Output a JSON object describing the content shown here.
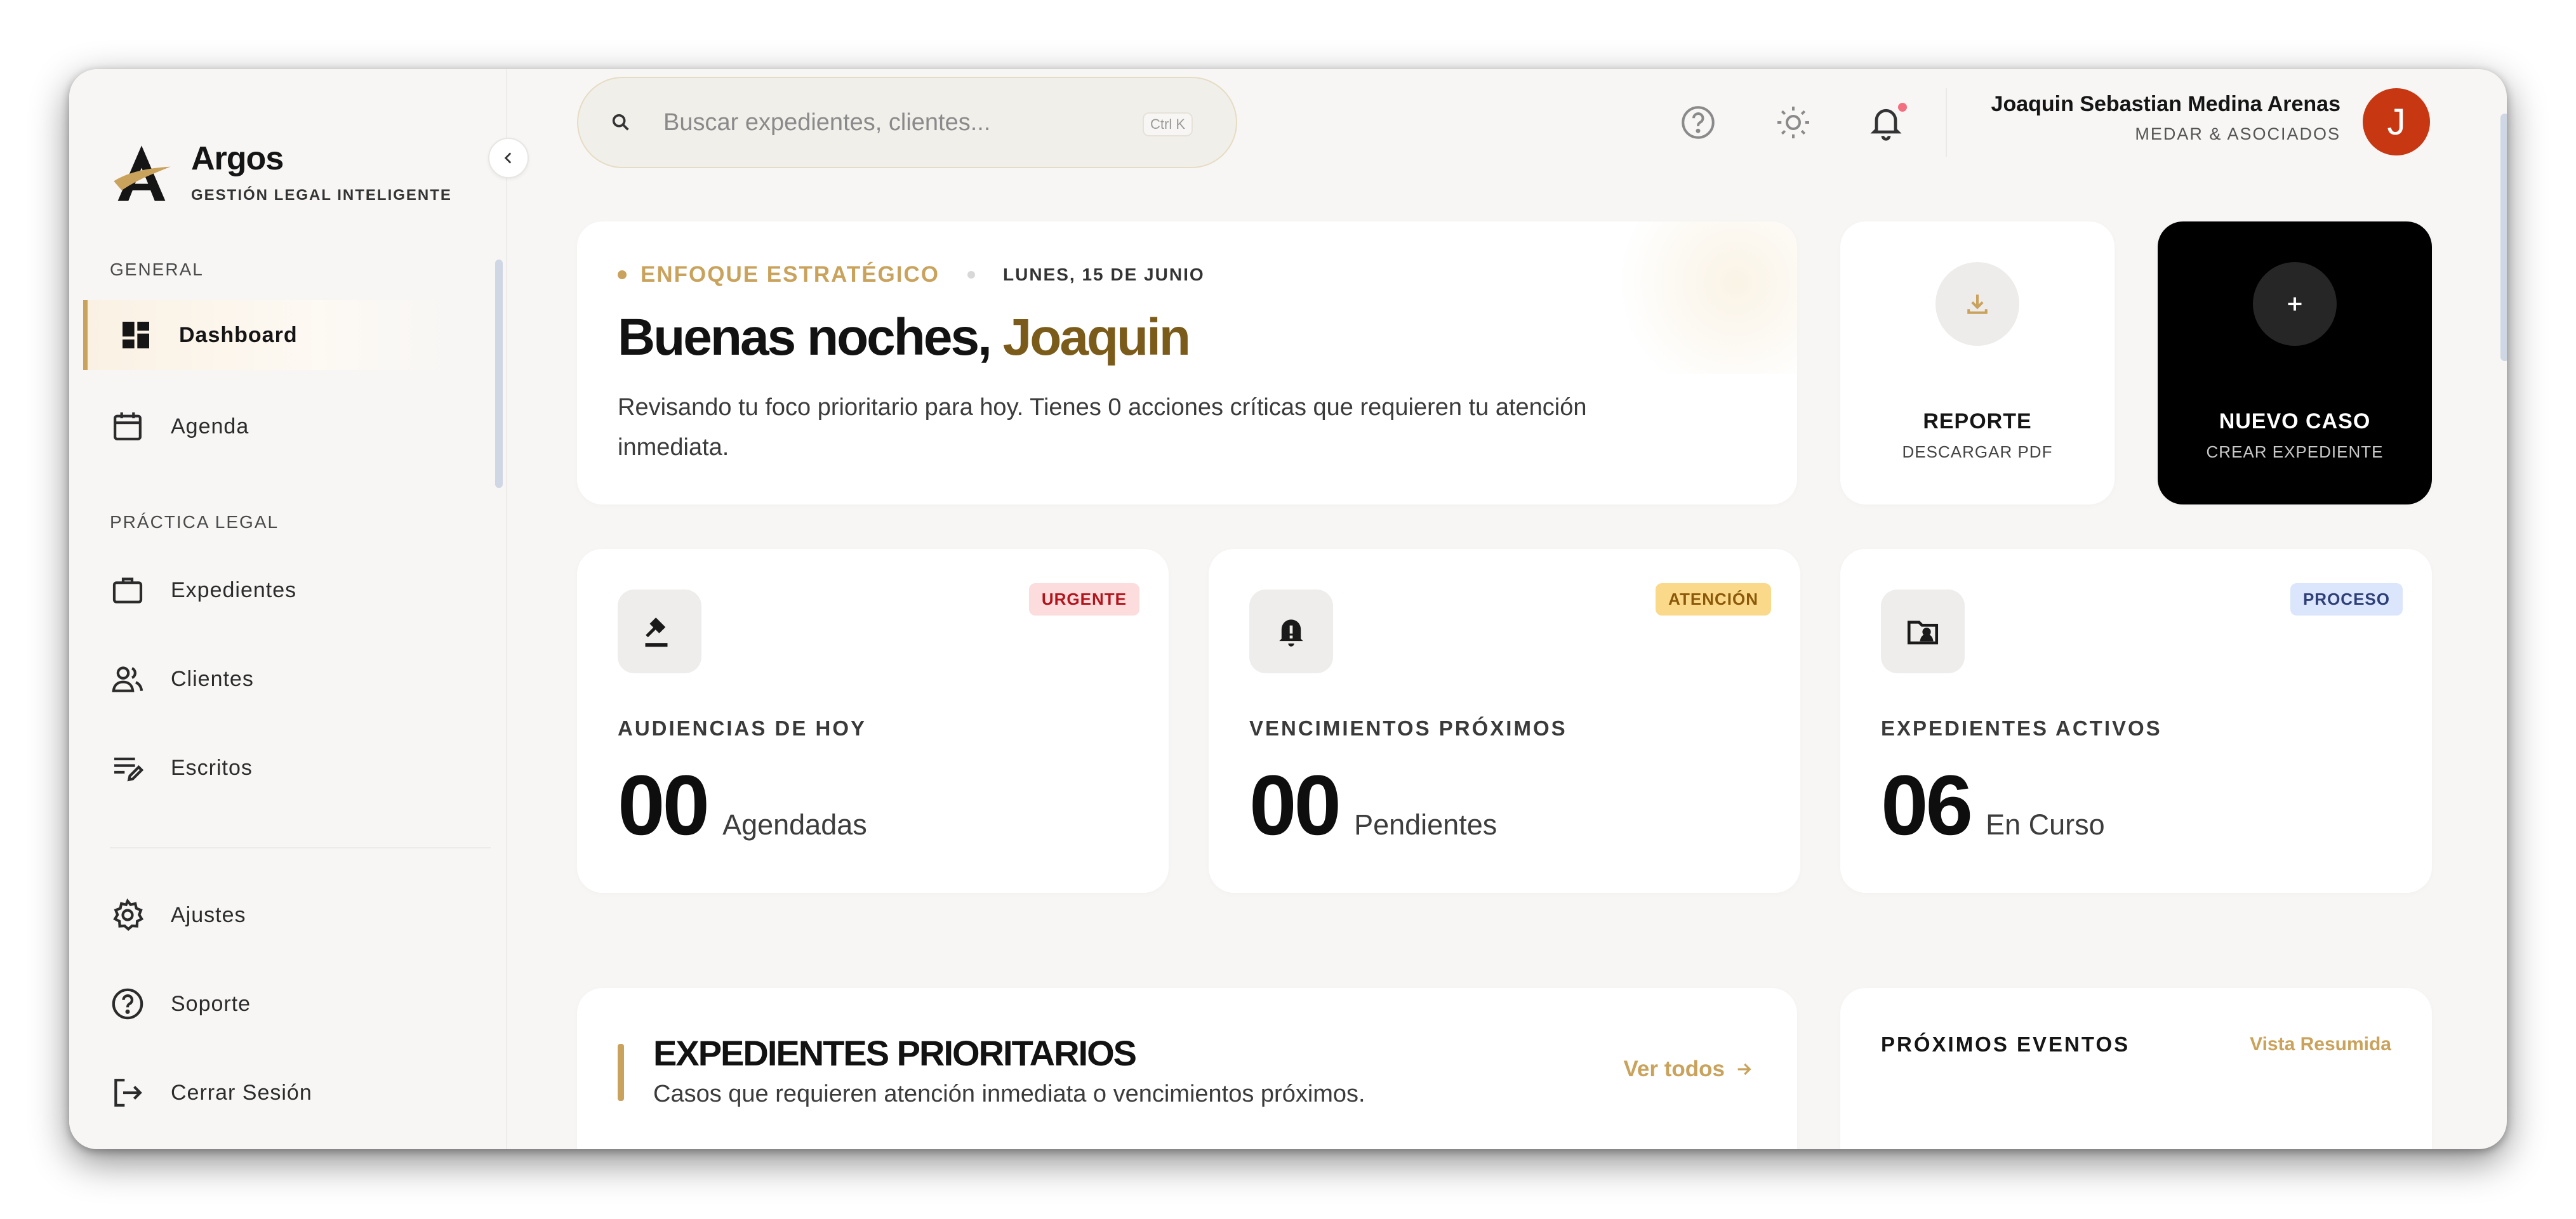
{
  "brand": {
    "name": "Argos",
    "tagline": "GESTIÓN LEGAL INTELIGENTE"
  },
  "sidebar": {
    "section_general": "GENERAL",
    "section_practice": "PRÁCTICA LEGAL",
    "items": [
      {
        "label": "Dashboard",
        "icon": "dashboard-icon",
        "active": true
      },
      {
        "label": "Agenda",
        "icon": "calendar-icon"
      },
      {
        "label": "Expedientes",
        "icon": "briefcase-icon"
      },
      {
        "label": "Clientes",
        "icon": "users-icon"
      },
      {
        "label": "Escritos",
        "icon": "edit-notes-icon"
      }
    ],
    "bottom_items": [
      {
        "label": "Ajustes",
        "icon": "gear-icon"
      },
      {
        "label": "Soporte",
        "icon": "help-icon"
      },
      {
        "label": "Cerrar Sesión",
        "icon": "logout-icon"
      }
    ]
  },
  "search": {
    "placeholder": "Buscar expedientes, clientes...",
    "shortcut": "Ctrl K"
  },
  "user": {
    "name": "Joaquin Sebastian Medina Arenas",
    "org": "MEDAR & ASOCIADOS",
    "initial": "J",
    "avatar_color": "#c73712"
  },
  "hero": {
    "tag": "ENFOQUE ESTRATÉGICO",
    "date": "LUNES, 15 DE JUNIO",
    "greeting": "Buenas noches,",
    "name": "Joaquin",
    "description": "Revisando tu foco prioritario para hoy. Tienes 0 acciones críticas que requieren tu atención inmediata."
  },
  "actions": {
    "report": {
      "title": "REPORTE",
      "subtitle": "DESCARGAR PDF"
    },
    "new_case": {
      "title": "NUEVO CASO",
      "subtitle": "CREAR EXPEDIENTE"
    }
  },
  "stats": [
    {
      "badge": "URGENTE",
      "label": "AUDIENCIAS DE HOY",
      "value": "00",
      "unit": "Agendadas",
      "icon": "gavel-icon"
    },
    {
      "badge": "ATENCIÓN",
      "label": "VENCIMIENTOS PRÓXIMOS",
      "value": "00",
      "unit": "Pendientes",
      "icon": "bell-alert-icon"
    },
    {
      "badge": "PROCESO",
      "label": "EXPEDIENTES ACTIVOS",
      "value": "06",
      "unit": "En Curso",
      "icon": "folder-user-icon"
    }
  ],
  "priority": {
    "title": "EXPEDIENTES PRIORITARIOS",
    "subtitle": "Casos que requieren atención inmediata o vencimientos próximos.",
    "link": "Ver todos"
  },
  "events": {
    "title": "PRÓXIMOS EVENTOS",
    "link": "Vista Resumida"
  },
  "colors": {
    "accent": "#c9a25c",
    "accent_dark": "#7a5b1a",
    "urgent": "#b3141c",
    "attention": "#8a5a0a",
    "process": "#2e3f78"
  }
}
